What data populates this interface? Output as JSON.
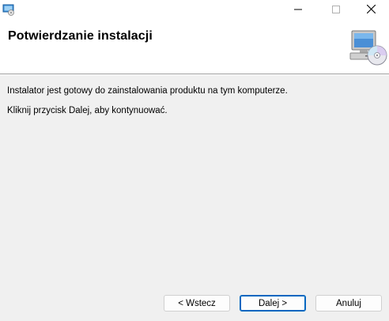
{
  "window": {
    "icon": "installer-icon",
    "controls": [
      "minimize-icon",
      "maximize-icon",
      "close-icon"
    ]
  },
  "header": {
    "title": "Potwierdzanie instalacji",
    "icon": "computer-cd-icon"
  },
  "body": {
    "line1": "Instalator jest gotowy do zainstalowania produktu na tym komputerze.",
    "line2": "Kliknij przycisk Dalej, aby kontynuować."
  },
  "buttons": {
    "back": "< Wstecz",
    "next": "Dalej >",
    "cancel": "Anuluj"
  },
  "colors": {
    "accent": "#0067c0",
    "background": "#f0f0f0",
    "header_background": "#ffffff"
  }
}
